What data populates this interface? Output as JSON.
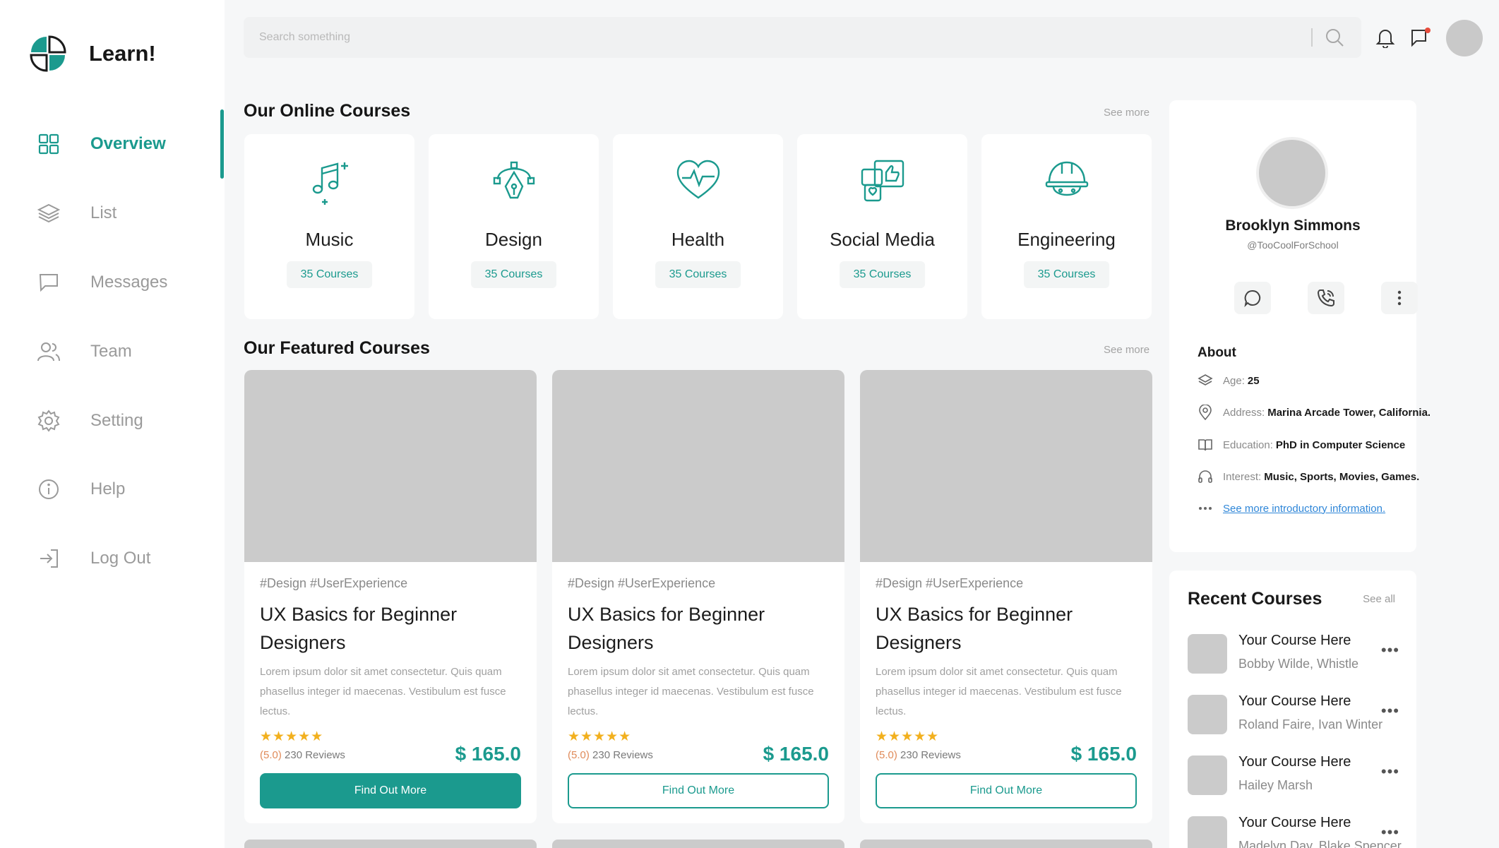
{
  "brand": {
    "name": "Learn!",
    "accent": "#1b9a8e"
  },
  "sidebar": {
    "items": [
      {
        "label": "Overview",
        "icon": "grid-icon",
        "active": true
      },
      {
        "label": "List",
        "icon": "layers-icon"
      },
      {
        "label": "Messages",
        "icon": "message-icon"
      },
      {
        "label": "Team",
        "icon": "team-icon"
      },
      {
        "label": "Setting",
        "icon": "gear-icon"
      },
      {
        "label": "Help",
        "icon": "info-icon"
      },
      {
        "label": "Log Out",
        "icon": "logout-icon"
      }
    ]
  },
  "header": {
    "search_placeholder": "Search something"
  },
  "online": {
    "title": "Our Online Courses",
    "see_more": "See more",
    "categories": [
      {
        "name": "Music",
        "count": "35 Courses",
        "icon": "music-icon"
      },
      {
        "name": "Design",
        "count": "35 Courses",
        "icon": "pen-tool-icon"
      },
      {
        "name": "Health",
        "count": "35 Courses",
        "icon": "heartbeat-icon"
      },
      {
        "name": "Social Media",
        "count": "35 Courses",
        "icon": "social-media-icon"
      },
      {
        "name": "Engineering",
        "count": "35 Courses",
        "icon": "helmet-icon"
      }
    ]
  },
  "featured": {
    "title": "Our Featured Courses",
    "see_more": "See more",
    "courses": [
      {
        "tags": "#Design  #UserExperience",
        "title": "UX Basics for Beginner Designers",
        "desc": "Lorem ipsum dolor sit amet consectetur. Quis quam phasellus integer id maecenas. Vestibulum est fusce lectus.",
        "stars": "★★★★★",
        "rating": "(5.0)",
        "reviews": "230 Reviews",
        "price": "$ 165.0",
        "cta": "Find Out More",
        "primary": true
      },
      {
        "tags": "#Design  #UserExperience",
        "title": "UX Basics for Beginner Designers",
        "desc": "Lorem ipsum dolor sit amet consectetur. Quis quam phasellus integer id maecenas. Vestibulum est fusce lectus.",
        "stars": "★★★★★",
        "rating": "(5.0)",
        "reviews": "230 Reviews",
        "price": "$ 165.0",
        "cta": "Find Out More",
        "primary": false
      },
      {
        "tags": "#Design  #UserExperience",
        "title": "UX Basics for Beginner Designers",
        "desc": "Lorem ipsum dolor sit amet consectetur. Quis quam phasellus integer id maecenas. Vestibulum est fusce lectus.",
        "stars": "★★★★★",
        "rating": "(5.0)",
        "reviews": "230 Reviews",
        "price": "$ 165.0",
        "cta": "Find Out More",
        "primary": false
      }
    ]
  },
  "profile": {
    "name": "Brooklyn Simmons",
    "handle": "@TooCoolForSchool",
    "about_title": "About",
    "info": [
      {
        "label": "Age:",
        "value": "25",
        "icon": "layers-icon"
      },
      {
        "label": "Address:",
        "value": "Marina Arcade Tower, California.",
        "icon": "location-pin-icon"
      },
      {
        "label": "Education:",
        "value": "PhD in Computer Science",
        "icon": "book-icon"
      },
      {
        "label": "Interest:",
        "value": "Music, Sports, Movies, Games.",
        "icon": "headphones-icon"
      }
    ],
    "more_link": "See more introductory information."
  },
  "recent": {
    "title": "Recent Courses",
    "see_all": "See all",
    "items": [
      {
        "name": "Your Course Here",
        "author": "Bobby Wilde, Whistle"
      },
      {
        "name": "Your Course Here",
        "author": "Roland Faire, Ivan Winter"
      },
      {
        "name": "Your Course Here",
        "author": "Hailey Marsh"
      },
      {
        "name": "Your Course Here",
        "author": "Madelyn Day, Blake Spencer"
      }
    ],
    "more_glyph": "•••"
  }
}
